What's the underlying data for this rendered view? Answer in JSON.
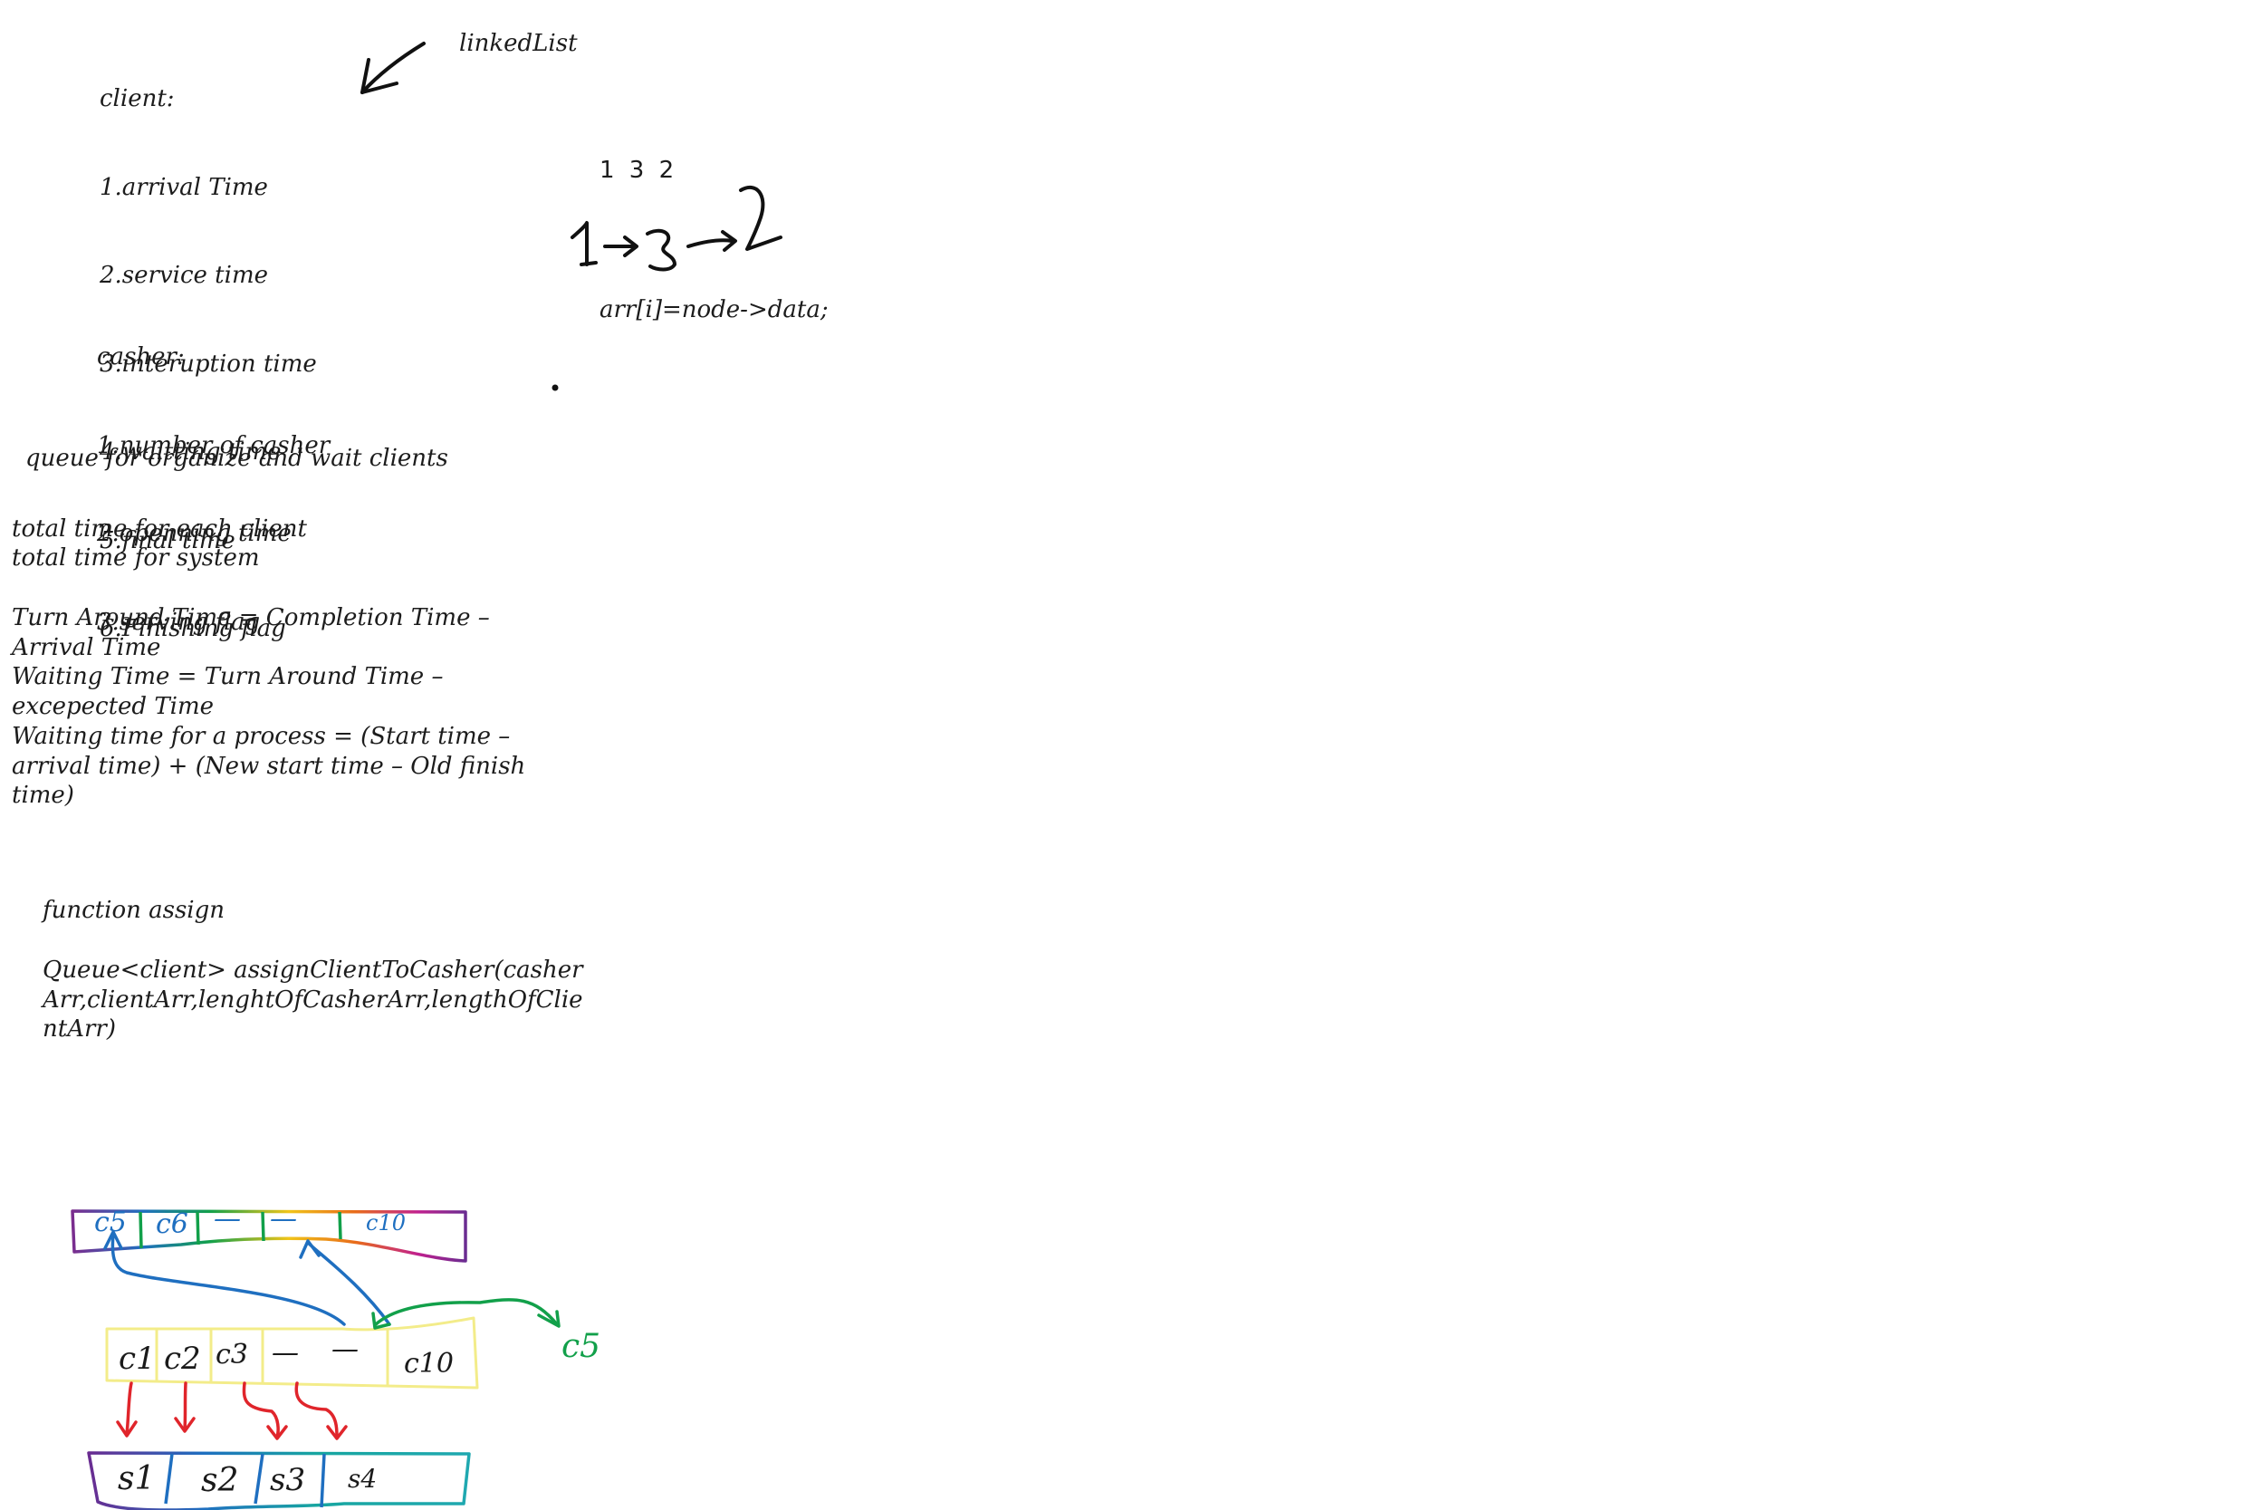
{
  "client_block": {
    "title": "client:",
    "items": [
      "1.arrival Time",
      "2.service time",
      "3.interuption time",
      "4.waitting time",
      "5.final time",
      "6.Finishing flag"
    ]
  },
  "casher_block": {
    "title": "casher:",
    "items": [
      "1.number of casher",
      "2.openning time",
      "3.serving flag"
    ]
  },
  "linked_list": {
    "label": "linkedList",
    "sequence": "1 3 2",
    "code": "arr[i]=node->data;"
  },
  "notes": {
    "queue": "queue for organize and wait clients",
    "total_each": "total time for each client",
    "total_system": "total time for system",
    "turn_around": "Turn Around Time = Completion Time – Arrival Time",
    "waiting": "Waiting Time = Turn Around Time – excepected Time",
    "waiting_process": "Waiting time for a process = (Start time – arrival time) + (New start time – Old finish time)"
  },
  "function_block": {
    "heading": "function assign",
    "signature": "Queue<client> assignClientToCasher(casherArr,clientArr,lenghtOfCasherArr,lengthOfClientArr)"
  },
  "diagram": {
    "top_row": [
      "c5",
      "c6",
      "—",
      "—",
      "c10"
    ],
    "middle_row": [
      "c1",
      "c2",
      "c3",
      "—",
      "—",
      "c10"
    ],
    "bottom_row": [
      "s1",
      "s2",
      "s3",
      "s4"
    ],
    "side_label": "c5",
    "colors": {
      "blue": "#1f6fc0",
      "green": "#12a04a",
      "red": "#e0252b",
      "yellow": "#f3ec8a"
    }
  }
}
